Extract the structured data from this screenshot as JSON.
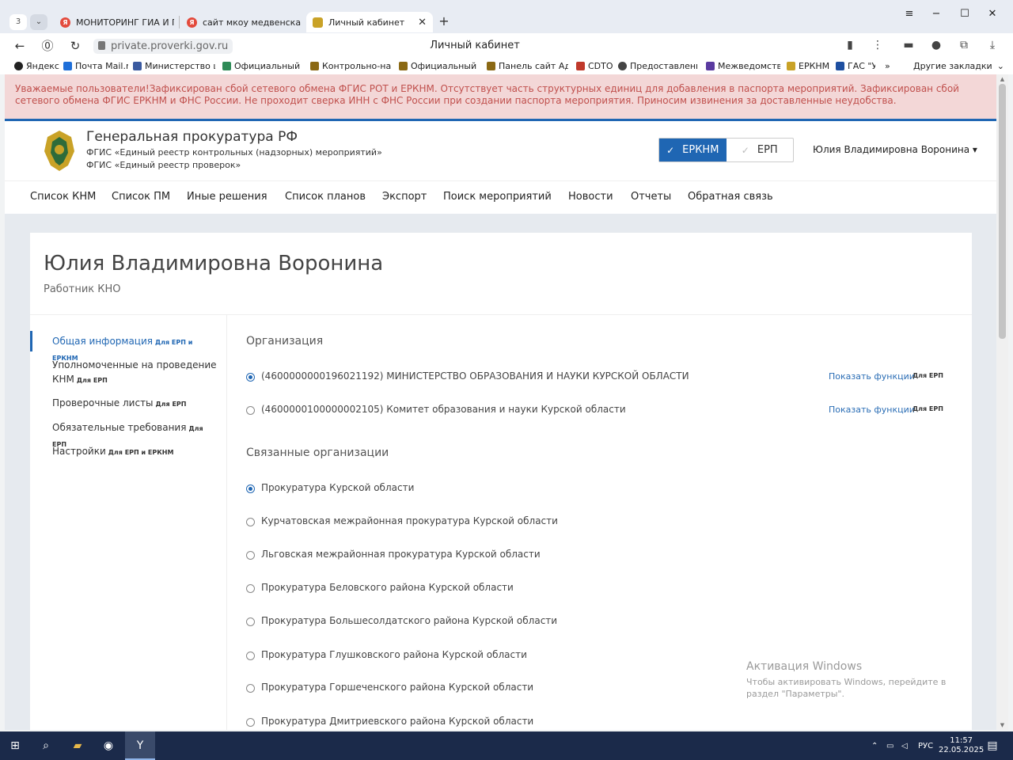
{
  "browser": {
    "tab_counter": "3",
    "tabs": [
      {
        "title": "МОНИТОРИНГ ГИА И ПР"
      },
      {
        "title": "сайт мкоу медвенская со"
      },
      {
        "title": "Личный кабинет"
      }
    ],
    "url": "private.proverki.gov.ru",
    "page_title": "Личный кабинет",
    "bookmarks": [
      {
        "label": "Яндекс",
        "color": "#222222"
      },
      {
        "label": "Почта Mail.ru",
        "color": "#1e6fd9"
      },
      {
        "label": "Министерство ци",
        "color": "#3a5aa0"
      },
      {
        "label": "Официальный са",
        "color": "#2e8b57"
      },
      {
        "label": "Контрольно-надз",
        "color": "#8b6914"
      },
      {
        "label": "Официальный са",
        "color": "#8b6914"
      },
      {
        "label": "Панель сайт Адм",
        "color": "#8b6914"
      },
      {
        "label": "CDTO",
        "color": "#c0392b"
      },
      {
        "label": "Предоставление",
        "color": "#444444"
      },
      {
        "label": "Межведомство",
        "color": "#5a3aa0"
      },
      {
        "label": "ЕРКНМ",
        "color": "#c9a227"
      },
      {
        "label": "ГАС \"У",
        "color": "#1e4fa0"
      }
    ],
    "bookmarks_more": "»",
    "other_bookmarks": "Другие закладки"
  },
  "alert": {
    "text": "Уважаемые пользователи!Зафиксирован сбой сетевого обмена ФГИС РОТ и ЕРКНМ. Отсутствует часть структурных единиц для добавления в паспорта мероприятий. Зафиксирован сбой сетевого обмена ФГИС ЕРКНМ и ФНС России. Не проходит сверка ИНН с ФНС России при создании паспорта мероприятия. Приносим извинения за доставленные неудобства."
  },
  "header": {
    "org_name": "Генеральная прокуратура РФ",
    "sub1": "ФГИС «Единый реестр контрольных (надзорных) мероприятий»",
    "sub2": "ФГИС «Единый реестр проверок»",
    "switch_on": "ЕРКНМ",
    "switch_off": "ЕРП",
    "user": "Юлия Владимировна Воронина"
  },
  "nav": [
    "Список КНМ",
    "Список ПМ",
    "Иные решения",
    "Список планов",
    "Экспорт",
    "Поиск мероприятий",
    "Новости",
    "Отчеты",
    "Обратная связь"
  ],
  "profile": {
    "name": "Юлия Владимировна Воронина",
    "role": "Работник КНО"
  },
  "sidebar": [
    {
      "label": "Общая информация",
      "tag": "Для ЕРП и ЕРКНМ"
    },
    {
      "label": "Уполномоченные на проведение КНМ",
      "tag": "Для ЕРП"
    },
    {
      "label": "Проверочные листы",
      "tag": "Для ЕРП"
    },
    {
      "label": "Обязательные требования",
      "tag": "Для ЕРП"
    },
    {
      "label": "Настройки",
      "tag": "Для ЕРП и ЕРКНМ"
    }
  ],
  "organization": {
    "title": "Организация",
    "items": [
      {
        "label": "(4600000000196021192) МИНИСТЕРСТВО ОБРАЗОВАНИЯ И НАУКИ КУРСКОЙ ОБЛАСТИ",
        "link": "Показать функции",
        "tag": "Для ЕРП"
      },
      {
        "label": "(4600000100000002105) Комитет образования и науки Курской области",
        "link": "Показать функции",
        "tag": "Для ЕРП"
      }
    ]
  },
  "related": {
    "title": "Связанные организации",
    "items": [
      "Прокуратура Курской области",
      "Курчатовская межрайонная прокуратура Курской области",
      "Льговская межрайонная прокуратура Курской области",
      "Прокуратура Беловского района Курской области",
      "Прокуратура Большесолдатского района Курской области",
      "Прокуратура Глушковского района Курской области",
      "Прокуратура Горшеченского района Курской области",
      "Прокуратура Дмитриевского района Курской области"
    ]
  },
  "watermark": {
    "line1": "Активация Windows",
    "line2": "Чтобы активировать Windows, перейдите в раздел \"Параметры\"."
  },
  "taskbar": {
    "lang": "РУС",
    "time": "11:57",
    "date": "22.05.2025"
  },
  "colors": {
    "accent": "#1f66b3",
    "alert_bg": "#f3d7d7",
    "alert_text": "#c0504d"
  }
}
